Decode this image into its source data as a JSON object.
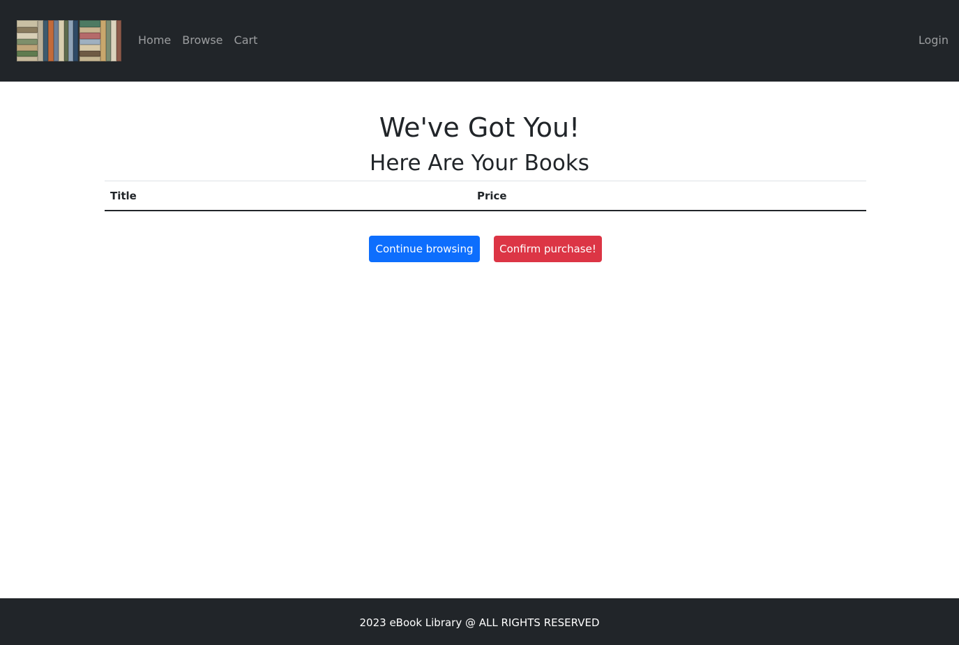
{
  "nav": {
    "logo_alt": "eBook Library logo",
    "links": [
      "Home",
      "Browse",
      "Cart"
    ],
    "login": "Login"
  },
  "main": {
    "title": "We've Got You!",
    "subtitle": "Here Are Your Books",
    "table": {
      "columns": [
        "Title",
        "Price"
      ],
      "rows": []
    },
    "buttons": {
      "continue": "Continue browsing",
      "confirm": "Confirm purchase!"
    }
  },
  "footer": {
    "text": "2023 eBook Library @ ALL RIGHTS RESERVED"
  },
  "colors": {
    "navbar_bg": "#212529",
    "primary": "#0d6efd",
    "danger": "#dc3545"
  }
}
